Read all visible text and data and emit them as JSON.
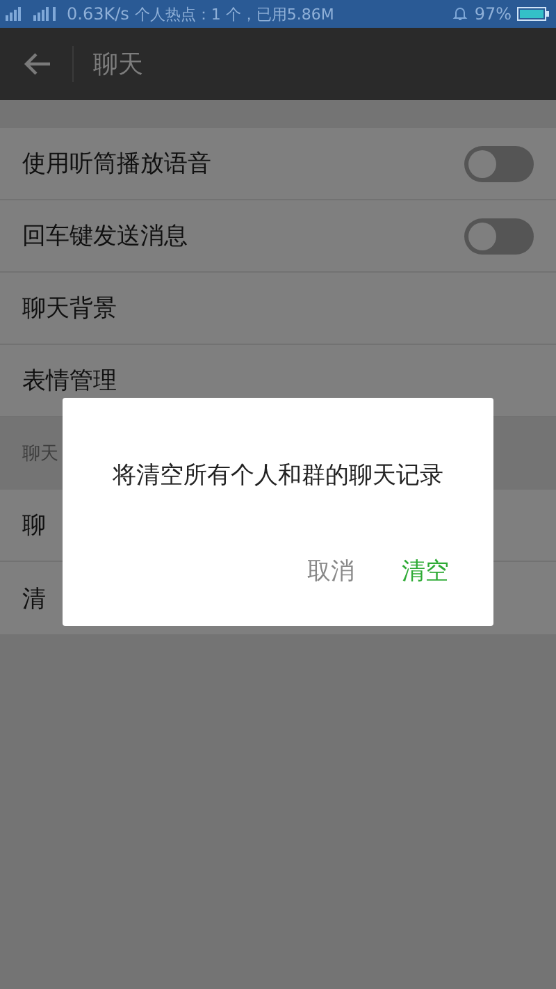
{
  "status_bar": {
    "speed": "0.63K/s",
    "hotspot": "个人热点：1 个，已用5.86M",
    "battery": "97%"
  },
  "app_bar": {
    "title": "聊天"
  },
  "settings": [
    {
      "kind": "toggle",
      "label": "使用听筒播放语音",
      "on": false
    },
    {
      "kind": "toggle",
      "label": "回车键发送消息",
      "on": false
    },
    {
      "kind": "item",
      "label": "聊天背景"
    },
    {
      "kind": "item",
      "label": "表情管理"
    },
    {
      "kind": "header",
      "label": "聊天"
    },
    {
      "kind": "item",
      "label": "聊"
    },
    {
      "kind": "item",
      "label": "清"
    }
  ],
  "dialog": {
    "message": "将清空所有个人和群的聊天记录",
    "buttons": [
      {
        "label": "取消",
        "kind": "cancel"
      },
      {
        "label": "清空",
        "kind": "confirm"
      }
    ]
  }
}
